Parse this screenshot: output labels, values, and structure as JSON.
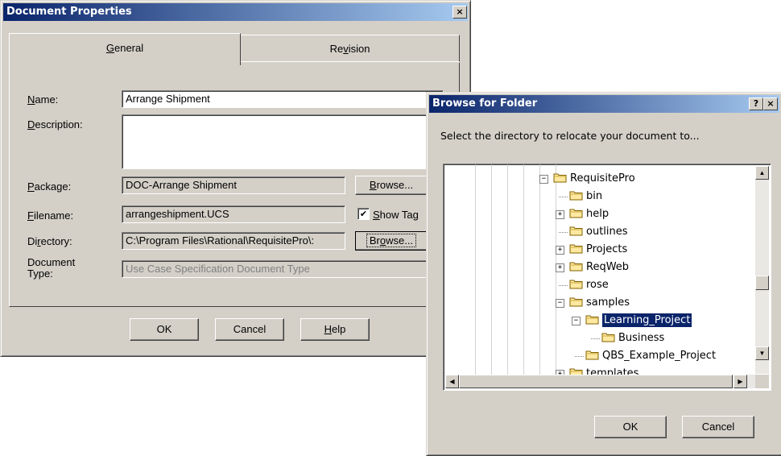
{
  "doc_props": {
    "title": "Document Properties",
    "close_glyph": "×",
    "tabs": [
      {
        "pre": "",
        "u": "G",
        "post": "eneral"
      },
      {
        "pre": "Re",
        "u": "v",
        "post": "ision"
      }
    ],
    "labels": {
      "name": {
        "pre": "",
        "u": "N",
        "post": "ame:"
      },
      "description": {
        "pre": "",
        "u": "D",
        "post": "escription:"
      },
      "package": {
        "pre": "",
        "u": "P",
        "post": "ackage:"
      },
      "filename": {
        "pre": "",
        "u": "F",
        "post": "ilename:"
      },
      "directory": {
        "pre": "Di",
        "u": "r",
        "post": "ectory:"
      },
      "document_type_line1": "Document",
      "document_type_line2": "Type:"
    },
    "values": {
      "name": "Arrange Shipment",
      "description": "",
      "package": "DOC-Arrange Shipment",
      "filename": "arrangeshipment.UCS",
      "directory": "C:\\Program Files\\Rational\\RequisitePro\\:",
      "document_type": "Use Case Specification Document Type"
    },
    "browse_package": {
      "pre": "",
      "u": "B",
      "post": "rowse..."
    },
    "browse_directory": {
      "pre": "Br",
      "u": "o",
      "post": "wse..."
    },
    "show_tags": {
      "pre": "",
      "u": "S",
      "post": "how Tag",
      "checked": true
    },
    "buttons": {
      "ok": "OK",
      "cancel": "Cancel",
      "help": {
        "pre": "",
        "u": "H",
        "post": "elp"
      }
    }
  },
  "browse_folder": {
    "title": "Browse for Folder",
    "help_glyph": "?",
    "close_glyph": "×",
    "prompt": "Select the directory to relocate your document to...",
    "tree": [
      {
        "label": "RequisitePro",
        "expander": "−"
      },
      {
        "label": "bin",
        "expander": ""
      },
      {
        "label": "help",
        "expander": "+"
      },
      {
        "label": "outlines",
        "expander": ""
      },
      {
        "label": "Projects",
        "expander": "+"
      },
      {
        "label": "ReqWeb",
        "expander": "+"
      },
      {
        "label": "rose",
        "expander": ""
      },
      {
        "label": "samples",
        "expander": "−"
      },
      {
        "label": "Learning_Project",
        "expander": "−",
        "selected": true
      },
      {
        "label": "Business",
        "expander": ""
      },
      {
        "label": "QBS_Example_Project",
        "expander": ""
      },
      {
        "label": "templates",
        "expander": "+"
      }
    ],
    "buttons": {
      "ok": "OK",
      "cancel": "Cancel"
    }
  }
}
